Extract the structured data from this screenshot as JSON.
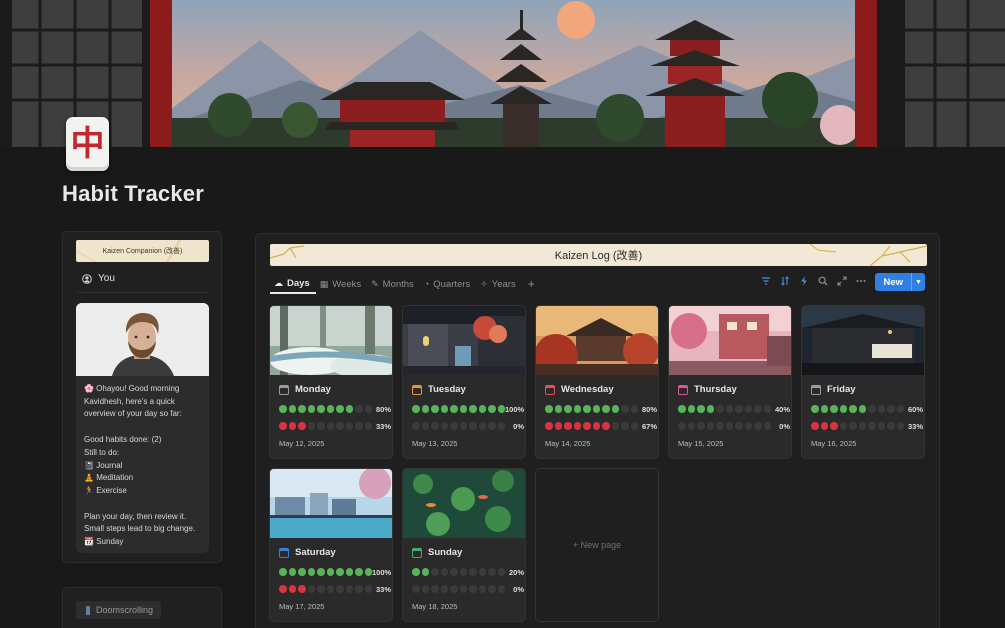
{
  "page": {
    "title": "Habit Tracker",
    "icon_glyph": "中"
  },
  "sidebar": {
    "banner_text": "Kaizen Companion (改善)",
    "you_label": "You",
    "greeting": "🌸 Ohayou! Good morning Kavidhesh, here's a quick overview of your day so far:",
    "good_habits": "Good habits done: (2)",
    "still_to_do": "Still to do:",
    "todo": [
      {
        "icon": "📓",
        "label": "Journal"
      },
      {
        "icon": "🧘",
        "label": "Meditation"
      },
      {
        "icon": "🏃",
        "label": "Exercise"
      }
    ],
    "plan_line_1": "Plan your day, then review it.",
    "plan_line_2": "Small steps lead to big change.",
    "day_icon": "📆",
    "day_label": "Sunday",
    "second_card_pill": "Doomscrolling"
  },
  "database": {
    "banner_text": "Kaizen Log (改善)",
    "tabs": [
      {
        "label": "Days",
        "icon": "☁",
        "active": true
      },
      {
        "label": "Weeks",
        "icon": "▦",
        "active": false
      },
      {
        "label": "Months",
        "icon": "✎",
        "active": false
      },
      {
        "label": "Quarters",
        "icon": "◔",
        "active": false
      },
      {
        "label": "Years",
        "icon": "✧",
        "active": false
      }
    ],
    "add_tab": "+",
    "new_button": "New",
    "new_page_label": "+ New page",
    "colors": {
      "good": "#58b35b",
      "bad": "#d8333f",
      "empty": "#3b3b3b",
      "accent": "#2f80e4"
    },
    "days": [
      {
        "name": "Monday",
        "cal_color": "#9b9b9b",
        "good": 0.8,
        "good_pct": "80%",
        "bad": 0.33,
        "bad_pct": "33%",
        "date": "May 12, 2025",
        "scene": "forest"
      },
      {
        "name": "Tuesday",
        "cal_color": "#e8923a",
        "good": 1.0,
        "good_pct": "100%",
        "bad": 0.0,
        "bad_pct": "0%",
        "date": "May 13, 2025",
        "scene": "street"
      },
      {
        "name": "Wednesday",
        "cal_color": "#e0525c",
        "good": 0.8,
        "good_pct": "80%",
        "bad": 0.67,
        "bad_pct": "67%",
        "date": "May 14, 2025",
        "scene": "autumn"
      },
      {
        "name": "Thursday",
        "cal_color": "#d6589a",
        "good": 0.4,
        "good_pct": "40%",
        "bad": 0.0,
        "bad_pct": "0%",
        "date": "May 15, 2025",
        "scene": "pink"
      },
      {
        "name": "Friday",
        "cal_color": "#9b9b9b",
        "good": 0.6,
        "good_pct": "60%",
        "bad": 0.33,
        "bad_pct": "33%",
        "date": "May 16, 2025",
        "scene": "night"
      },
      {
        "name": "Saturday",
        "cal_color": "#3d7fd8",
        "good": 1.0,
        "good_pct": "100%",
        "bad": 0.33,
        "bad_pct": "33%",
        "date": "May 17, 2025",
        "scene": "lake"
      },
      {
        "name": "Sunday",
        "cal_color": "#3fae6a",
        "good": 0.2,
        "good_pct": "20%",
        "bad": 0.0,
        "bad_pct": "0%",
        "date": "May 18, 2025",
        "scene": "pond"
      }
    ]
  }
}
